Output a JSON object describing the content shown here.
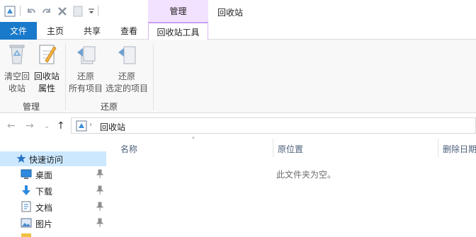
{
  "window": {
    "title": "回收站",
    "context_header": "管理"
  },
  "ribbon_tabs": {
    "file": "文件",
    "home": "主页",
    "share": "共享",
    "view": "查看",
    "recycle_tools": "回收站工具"
  },
  "ribbon": {
    "manage": {
      "empty_recycle_bin": "清空回\n收站",
      "properties": "回收站\n属性",
      "group_label": "管理"
    },
    "restore": {
      "restore_all": "还原\n所有项目",
      "restore_selected": "还原\n选定的项目",
      "group_label": "还原"
    }
  },
  "address": {
    "path": "回收站"
  },
  "nav_pane": {
    "quick_access": "快速访问",
    "items": [
      {
        "label": "桌面",
        "icon": "desktop-icon"
      },
      {
        "label": "下载",
        "icon": "download-icon"
      },
      {
        "label": "文档",
        "icon": "document-icon"
      },
      {
        "label": "图片",
        "icon": "pictures-icon"
      }
    ]
  },
  "content": {
    "columns": [
      "名称",
      "原位置",
      "删除日期"
    ],
    "empty_message": "此文件夹为空。"
  },
  "colors": {
    "file_tab": "#1979ca",
    "context_tab": "#f2e2ff",
    "selection": "#cce8ff"
  }
}
